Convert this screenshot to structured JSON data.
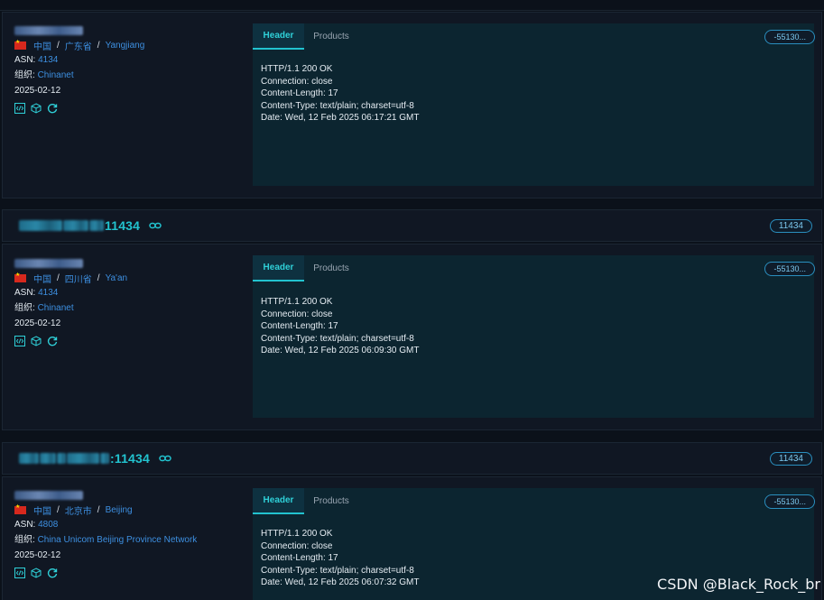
{
  "entries": [
    {
      "location": {
        "country": "中国",
        "province": "广东省",
        "city": "Yangjiang"
      },
      "asn_label": "ASN:",
      "asn": "4134",
      "org_label": "组织:",
      "org": "Chinanet",
      "date": "2025-02-12",
      "tabs": [
        "Header",
        "Products"
      ],
      "hash": "-55130...",
      "response": [
        "HTTP/1.1 200 OK",
        "Connection: close",
        "Content-Length: 17",
        "Content-Type: text/plain; charset=utf-8",
        "Date: Wed, 12 Feb 2025 06:17:21 GMT"
      ]
    },
    {
      "host_suffix": "11434",
      "port": "11434",
      "location": {
        "country": "中国",
        "province": "四川省",
        "city": "Ya'an"
      },
      "asn_label": "ASN:",
      "asn": "4134",
      "org_label": "组织:",
      "org": "Chinanet",
      "date": "2025-02-12",
      "tabs": [
        "Header",
        "Products"
      ],
      "hash": "-55130...",
      "response": [
        "HTTP/1.1 200 OK",
        "Connection: close",
        "Content-Length: 17",
        "Content-Type: text/plain; charset=utf-8",
        "Date: Wed, 12 Feb 2025 06:09:30 GMT"
      ]
    },
    {
      "host_suffix": ":11434",
      "port": "11434",
      "location": {
        "country": "中国",
        "province": "北京市",
        "city": "Beijing"
      },
      "asn_label": "ASN:",
      "asn": "4808",
      "org_label": "组织:",
      "org": "China Unicom Beijing Province Network",
      "date": "2025-02-12",
      "tabs": [
        "Header",
        "Products"
      ],
      "hash": "-55130...",
      "response": [
        "HTTP/1.1 200 OK",
        "Connection: close",
        "Content-Length: 17",
        "Content-Type: text/plain; charset=utf-8",
        "Date: Wed, 12 Feb 2025 06:07:32 GMT"
      ]
    }
  ],
  "icons": [
    "code-icon",
    "cube-icon",
    "refresh-icon",
    "link-icon",
    "flag-cn-icon"
  ],
  "colors": {
    "accent": "#22c3cf",
    "link": "#3d8fe0",
    "panel": "#0c2530",
    "background": "#0b111a"
  },
  "watermark": "CSDN @Black_Rock_br"
}
